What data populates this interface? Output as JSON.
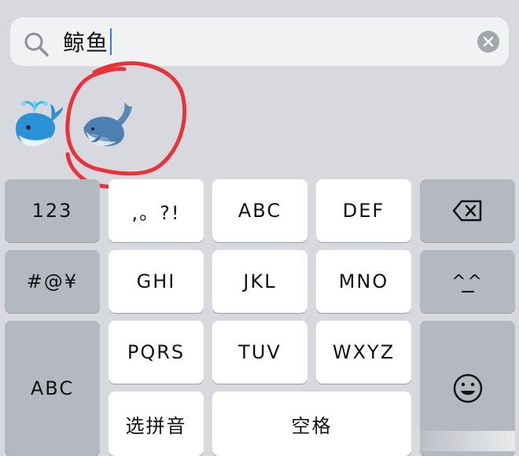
{
  "search": {
    "query": "鲸鱼"
  },
  "suggestions": [
    {
      "name": "spouting-whale",
      "glyph": "🐳"
    },
    {
      "name": "whale",
      "glyph": "🐋"
    }
  ],
  "keyboard": {
    "row1": {
      "left": "123",
      "k1": ",。?!",
      "k2": "ABC",
      "k3": "DEF"
    },
    "row2": {
      "left": "#@¥",
      "k1": "GHI",
      "k2": "JKL",
      "k3": "MNO",
      "right": "^^"
    },
    "row3": {
      "k1": "PQRS",
      "k2": "TUV",
      "k3": "WXYZ"
    },
    "row4": {
      "k1": "选拼音",
      "space": "空格"
    },
    "left_tall": "ABC"
  },
  "colors": {
    "background": "#d7d9de",
    "light_key": "#ffffff",
    "dark_key": "#b4b8c0",
    "annotation_red": "#e8333a"
  }
}
